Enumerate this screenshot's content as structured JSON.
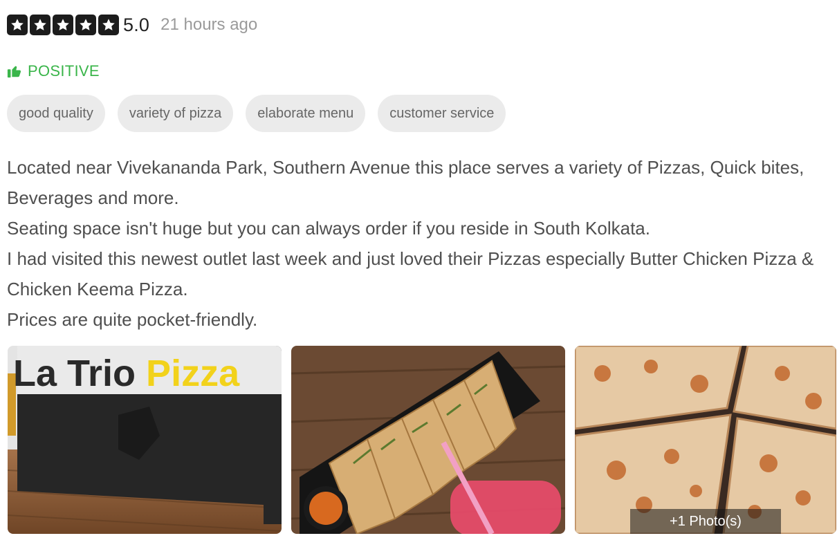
{
  "review": {
    "rating": {
      "stars": 5,
      "score": "5.0",
      "timestamp": "21 hours ago"
    },
    "sentiment": {
      "label": "POSITIVE",
      "icon": "thumbs-up-icon",
      "color": "#3ab54a"
    },
    "tags": [
      "good quality",
      "variety of pizza",
      "elaborate menu",
      "customer service"
    ],
    "text": [
      "Located near Vivekananda Park, Southern Avenue this place serves a variety of Pizzas, Quick bites, Beverages and more.",
      "Seating space isn't huge but you can always order if you reside in South Kolkata.",
      "I had visited this newest outlet last week and just loved their Pizzas especially Butter Chicken Pizza & Chicken Keema Pizza.",
      "Prices are quite pocket-friendly."
    ],
    "photos": {
      "sign_text": {
        "part1": "La Trio ",
        "part2": "Pizza"
      },
      "more_label": "+1 Photo(s)"
    }
  },
  "colors": {
    "star_bg": "#1c1c1c",
    "tag_bg": "#ebebeb",
    "sign_yellow": "#f2d21b"
  }
}
